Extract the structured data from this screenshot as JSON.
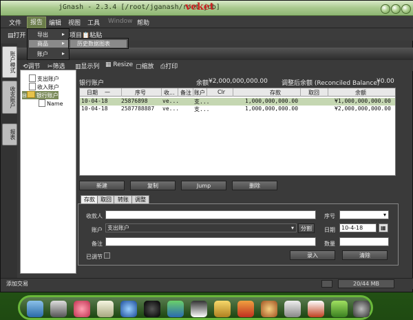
{
  "window": {
    "title": "jGnash - 2.3.4  [/root/jganash/root.jdb]",
    "brand": "veket"
  },
  "menubar": [
    "文件",
    "报告",
    "编辑",
    "视图",
    "工具",
    "Window",
    "帮助"
  ],
  "report_menu": {
    "items": [
      "导出",
      "商品",
      "账户"
    ],
    "submenu": [
      "历史数据图表"
    ]
  },
  "toolbar1": {
    "open": "打开",
    "export": "导出",
    "items": "项目",
    "paste": "粘贴"
  },
  "left_tabs": [
    "账户模式",
    "收支账户",
    "报表"
  ],
  "tree": {
    "items": [
      "支出账户",
      "收入账户",
      "银行账户",
      "Name"
    ]
  },
  "toolbar2": [
    "调节",
    "筛选",
    "显示列",
    "Resize",
    "缩放",
    "打印"
  ],
  "account": {
    "name": "银行账户",
    "balance_label": "余额",
    "balance": "¥2,000,000,000.00",
    "reconciled_label": "调整后余额 (Reconciled Balance)",
    "reconciled": "¥0.00"
  },
  "register": {
    "columns": [
      "日期",
      "序号",
      "收...",
      "备注",
      "账户",
      "Clr",
      "存款",
      "取回",
      "余额"
    ],
    "rows": [
      {
        "date": "10-04-18",
        "num": "25876898",
        "payee": "ve...",
        "memo": "",
        "account": "支...",
        "clr": "",
        "deposit": "1,000,000,000.00",
        "withdrawal": "",
        "balance": "¥1,000,000,000.00"
      },
      {
        "date": "10-04-18",
        "num": "2587788887",
        "payee": "ve...",
        "memo": "",
        "account": "支...",
        "clr": "",
        "deposit": "1,000,000,000.00",
        "withdrawal": "",
        "balance": "¥2,000,000,000.00"
      }
    ]
  },
  "actions": [
    "新建",
    "复制",
    "Jump",
    "删除"
  ],
  "form_tabs": [
    "存款",
    "取回",
    "转账",
    "调整"
  ],
  "form": {
    "payee_label": "收款人",
    "number_label": "序号",
    "account_label": "账户",
    "account_value": "支出账户",
    "split_button": "分割",
    "date_label": "日期",
    "date_value": "10-4-18",
    "memo_label": "备注",
    "amount_label": "数量",
    "reconciled_label": "已调节",
    "enter_button": "录入",
    "clear_button": "清除"
  },
  "status": {
    "message": "添加交易",
    "memory": "20/44 MB"
  },
  "dock": {
    "icons": [
      "drive-icon",
      "monitor-icon",
      "pig-icon",
      "notepad-icon",
      "globe-icon",
      "media-icon",
      "users-icon",
      "penguin-icon",
      "document-icon",
      "image-icon",
      "palette-icon",
      "usb-icon",
      "image2-icon",
      "help-icon",
      "webcam-icon"
    ]
  }
}
